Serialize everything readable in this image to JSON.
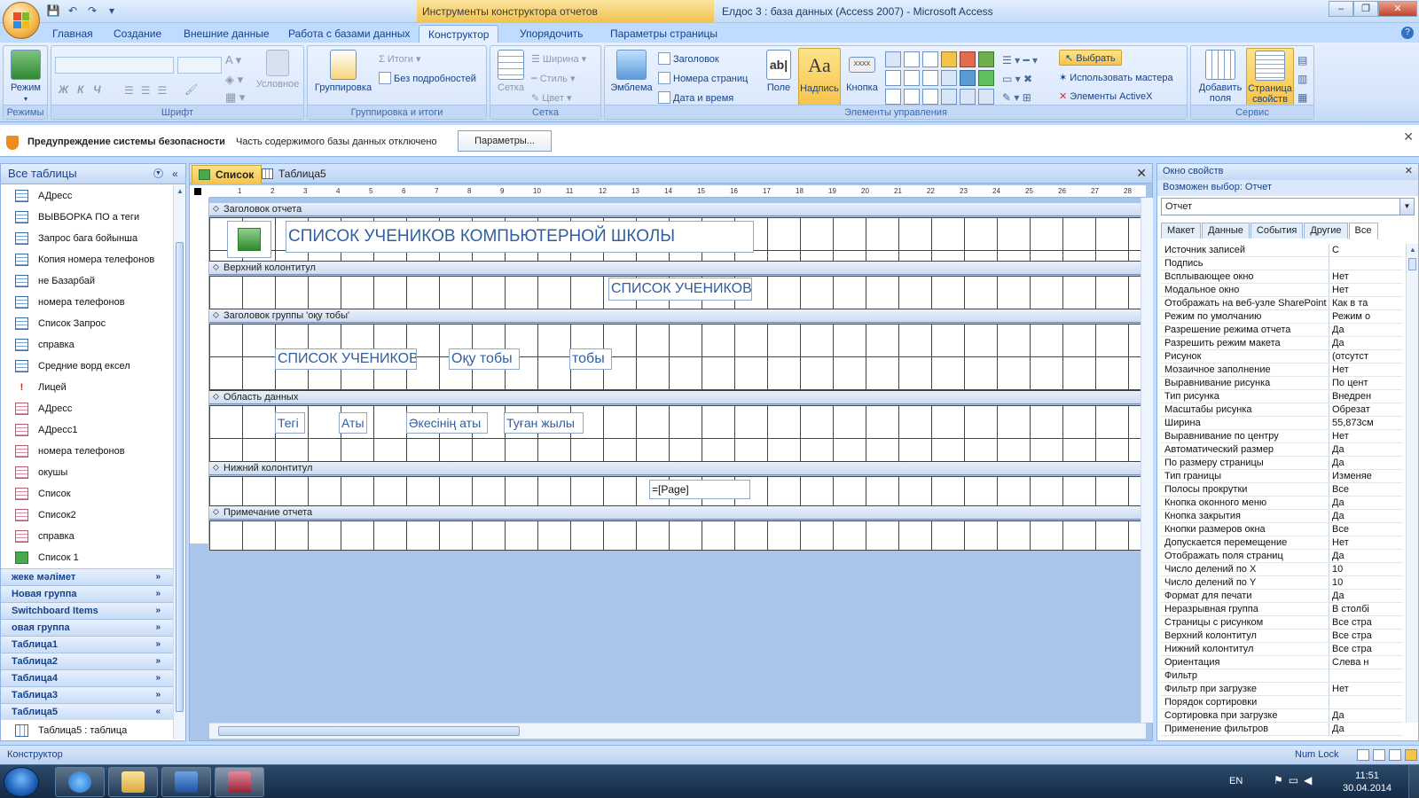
{
  "window": {
    "tools_context": "Инструменты конструктора отчетов",
    "title": "Елдос 3 : база данных (Access 2007) - Microsoft Access"
  },
  "ribbon_tabs": [
    "Главная",
    "Создание",
    "Внешние данные",
    "Работа с базами данных",
    "Конструктор",
    "Упорядочить",
    "Параметры страницы"
  ],
  "ribbon": {
    "groups": {
      "views": "Режимы",
      "font": "Шрифт",
      "grouping": "Группировка и итоги",
      "grid": "Сетка",
      "controls": "Элементы управления",
      "service": "Сервис"
    },
    "view_btn": "Режим",
    "conditional": "Условное",
    "grouping_btn": "Группировка",
    "totals": "Итоги",
    "hide_details": "Без подробностей",
    "grid_btn": "Сетка",
    "width": "Ширина",
    "style": "Стиль",
    "color": "Цвет",
    "logo": "Эмблема",
    "title_btn": "Заголовок",
    "page_numbers": "Номера страниц",
    "date_time": "Дата и время",
    "field": "Поле",
    "label": "Надпись",
    "button": "Кнопка",
    "select": "Выбрать",
    "wizard": "Использовать мастера",
    "activex": "Элементы ActiveX",
    "add_fields": "Добавить поля",
    "property_sheet": "Страница свойств"
  },
  "security": {
    "title": "Предупреждение системы безопасности",
    "message": "Часть содержимого базы данных отключено",
    "button": "Параметры..."
  },
  "nav": {
    "header": "Все таблицы",
    "items": [
      {
        "label": "АДресс",
        "type": "query"
      },
      {
        "label": "ВЫВБОРКА  ПО а теги",
        "type": "query"
      },
      {
        "label": "Запрос бага бойынша",
        "type": "query"
      },
      {
        "label": "Копия номера телефонов",
        "type": "query"
      },
      {
        "label": "не Базарбай",
        "type": "query"
      },
      {
        "label": "номера телефонов",
        "type": "query"
      },
      {
        "label": "Список Запрос",
        "type": "query"
      },
      {
        "label": "справка",
        "type": "query"
      },
      {
        "label": "Средние ворд ексел",
        "type": "query"
      },
      {
        "label": "Лицей",
        "type": "macro"
      },
      {
        "label": "АДресс",
        "type": "report"
      },
      {
        "label": "АДресс1",
        "type": "report"
      },
      {
        "label": "номера телефонов",
        "type": "report"
      },
      {
        "label": "окушы",
        "type": "report"
      },
      {
        "label": "Список",
        "type": "report"
      },
      {
        "label": "Список2",
        "type": "report"
      },
      {
        "label": "справка",
        "type": "report"
      },
      {
        "label": "Список 1",
        "type": "form"
      }
    ],
    "groups": [
      {
        "label": "жеке мәлімет",
        "chev": "»"
      },
      {
        "label": "Новая группа",
        "chev": "»"
      },
      {
        "label": "Switchboard Items",
        "chev": "»"
      },
      {
        "label": "овая группа",
        "chev": "»"
      },
      {
        "label": "Таблица1",
        "chev": "»"
      },
      {
        "label": "Таблица2",
        "chev": "»"
      },
      {
        "label": "Таблица4",
        "chev": "»"
      },
      {
        "label": "Таблица3",
        "chev": "»"
      },
      {
        "label": "Таблица5",
        "chev": "«"
      }
    ],
    "last_item": "Таблица5 : таблица"
  },
  "doc_tabs": [
    {
      "label": "Список",
      "active": true
    },
    {
      "label": "Таблица5",
      "active": false
    }
  ],
  "ruler_numbers": [
    "1",
    "2",
    "3",
    "4",
    "5",
    "6",
    "7",
    "8",
    "9",
    "10",
    "11",
    "12",
    "13",
    "14",
    "15",
    "16",
    "17",
    "18",
    "19",
    "20",
    "21",
    "22",
    "23",
    "24",
    "25",
    "26",
    "27",
    "28"
  ],
  "sections": {
    "report_header": "Заголовок отчета",
    "page_header": "Верхний колонтитул",
    "group_header": "Заголовок группы 'оқу тобы'",
    "detail": "Область данных",
    "page_footer": "Нижний колонтитул",
    "report_footer": "Примечание отчета"
  },
  "controls": {
    "report_title": "СПИСОК УЧЕНИКОВ КОМПЬЮТЕРНОЙ ШКОЛЫ",
    "page_title": "СПИСОК УЧЕНИКОВ",
    "group_title": "СПИСОК УЧЕНИКОВ",
    "group_label": "Оқу тобы",
    "group_field": "тобы",
    "detail_fields": [
      "Тегі",
      "Аты",
      "Әкесінің аты",
      "Туған жылы"
    ],
    "page_expr": "=[Page]"
  },
  "props": {
    "header": "Окно свойств",
    "selection_label": "Возможен выбор:  Отчет",
    "selected": "Отчет",
    "tabs": [
      "Макет",
      "Данные",
      "События",
      "Другие",
      "Все"
    ],
    "rows": [
      {
        "name": "Источник записей",
        "value": "С"
      },
      {
        "name": "Подпись",
        "value": ""
      },
      {
        "name": "Всплывающее окно",
        "value": "Нет"
      },
      {
        "name": "Модальное окно",
        "value": "Нет"
      },
      {
        "name": "Отображать на веб-узле SharePoint",
        "value": "Как в та"
      },
      {
        "name": "Режим по умолчанию",
        "value": "Режим о"
      },
      {
        "name": "Разрешение режима отчета",
        "value": "Да"
      },
      {
        "name": "Разрешить режим макета",
        "value": "Да"
      },
      {
        "name": "Рисунок",
        "value": "(отсутст"
      },
      {
        "name": "Мозаичное заполнение",
        "value": "Нет"
      },
      {
        "name": "Выравнивание рисунка",
        "value": "По цент"
      },
      {
        "name": "Тип рисунка",
        "value": "Внедрен"
      },
      {
        "name": "Масштабы рисунка",
        "value": "Обрезат"
      },
      {
        "name": "Ширина",
        "value": "55,873см"
      },
      {
        "name": "Выравнивание по центру",
        "value": "Нет"
      },
      {
        "name": "Автоматический размер",
        "value": "Да"
      },
      {
        "name": "По размеру страницы",
        "value": "Да"
      },
      {
        "name": "Тип границы",
        "value": "Изменяе"
      },
      {
        "name": "Полосы прокрутки",
        "value": "Все"
      },
      {
        "name": "Кнопка оконного меню",
        "value": "Да"
      },
      {
        "name": "Кнопка закрытия",
        "value": "Да"
      },
      {
        "name": "Кнопки размеров окна",
        "value": "Все"
      },
      {
        "name": "Допускается перемещение",
        "value": "Нет"
      },
      {
        "name": "Отображать поля страниц",
        "value": "Да"
      },
      {
        "name": "Число делений по X",
        "value": "10"
      },
      {
        "name": "Число делений по Y",
        "value": "10"
      },
      {
        "name": "Формат для печати",
        "value": "Да"
      },
      {
        "name": "Неразрывная группа",
        "value": "В столбі"
      },
      {
        "name": "Страницы с рисунком",
        "value": "Все стра"
      },
      {
        "name": "Верхний колонтитул",
        "value": "Все стра"
      },
      {
        "name": "Нижний колонтитул",
        "value": "Все стра"
      },
      {
        "name": "Ориентация",
        "value": "Слева н"
      },
      {
        "name": "Фильтр",
        "value": ""
      },
      {
        "name": "Фильтр при загрузке",
        "value": "Нет"
      },
      {
        "name": "Порядок сортировки",
        "value": ""
      },
      {
        "name": "Сортировка при загрузке",
        "value": "Да"
      },
      {
        "name": "Применение фильтров",
        "value": "Да"
      }
    ]
  },
  "status": {
    "mode": "Конструктор",
    "numlock": "Num Lock"
  },
  "taskbar": {
    "lang": "EN",
    "time": "11:51",
    "date": "30.04.2014"
  }
}
